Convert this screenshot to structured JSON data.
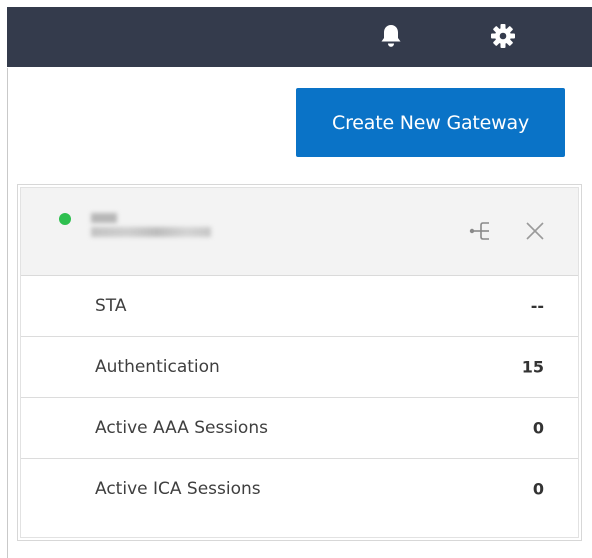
{
  "topbar": {
    "notifications_icon": "bell-icon",
    "settings_icon": "gear-icon",
    "background_color": "#343b4c"
  },
  "actions": {
    "create_gateway_label": "Create New Gateway",
    "button_color": "#0a73c7"
  },
  "gateway_card": {
    "status": "online",
    "status_color": "#2ebf4f",
    "topology_icon": "topology-icon",
    "close_icon": "close-icon",
    "metrics": [
      {
        "label": "STA",
        "value": "--"
      },
      {
        "label": "Authentication",
        "value": "15"
      },
      {
        "label": "Active AAA Sessions",
        "value": "0"
      },
      {
        "label": "Active ICA Sessions",
        "value": "0"
      }
    ]
  }
}
